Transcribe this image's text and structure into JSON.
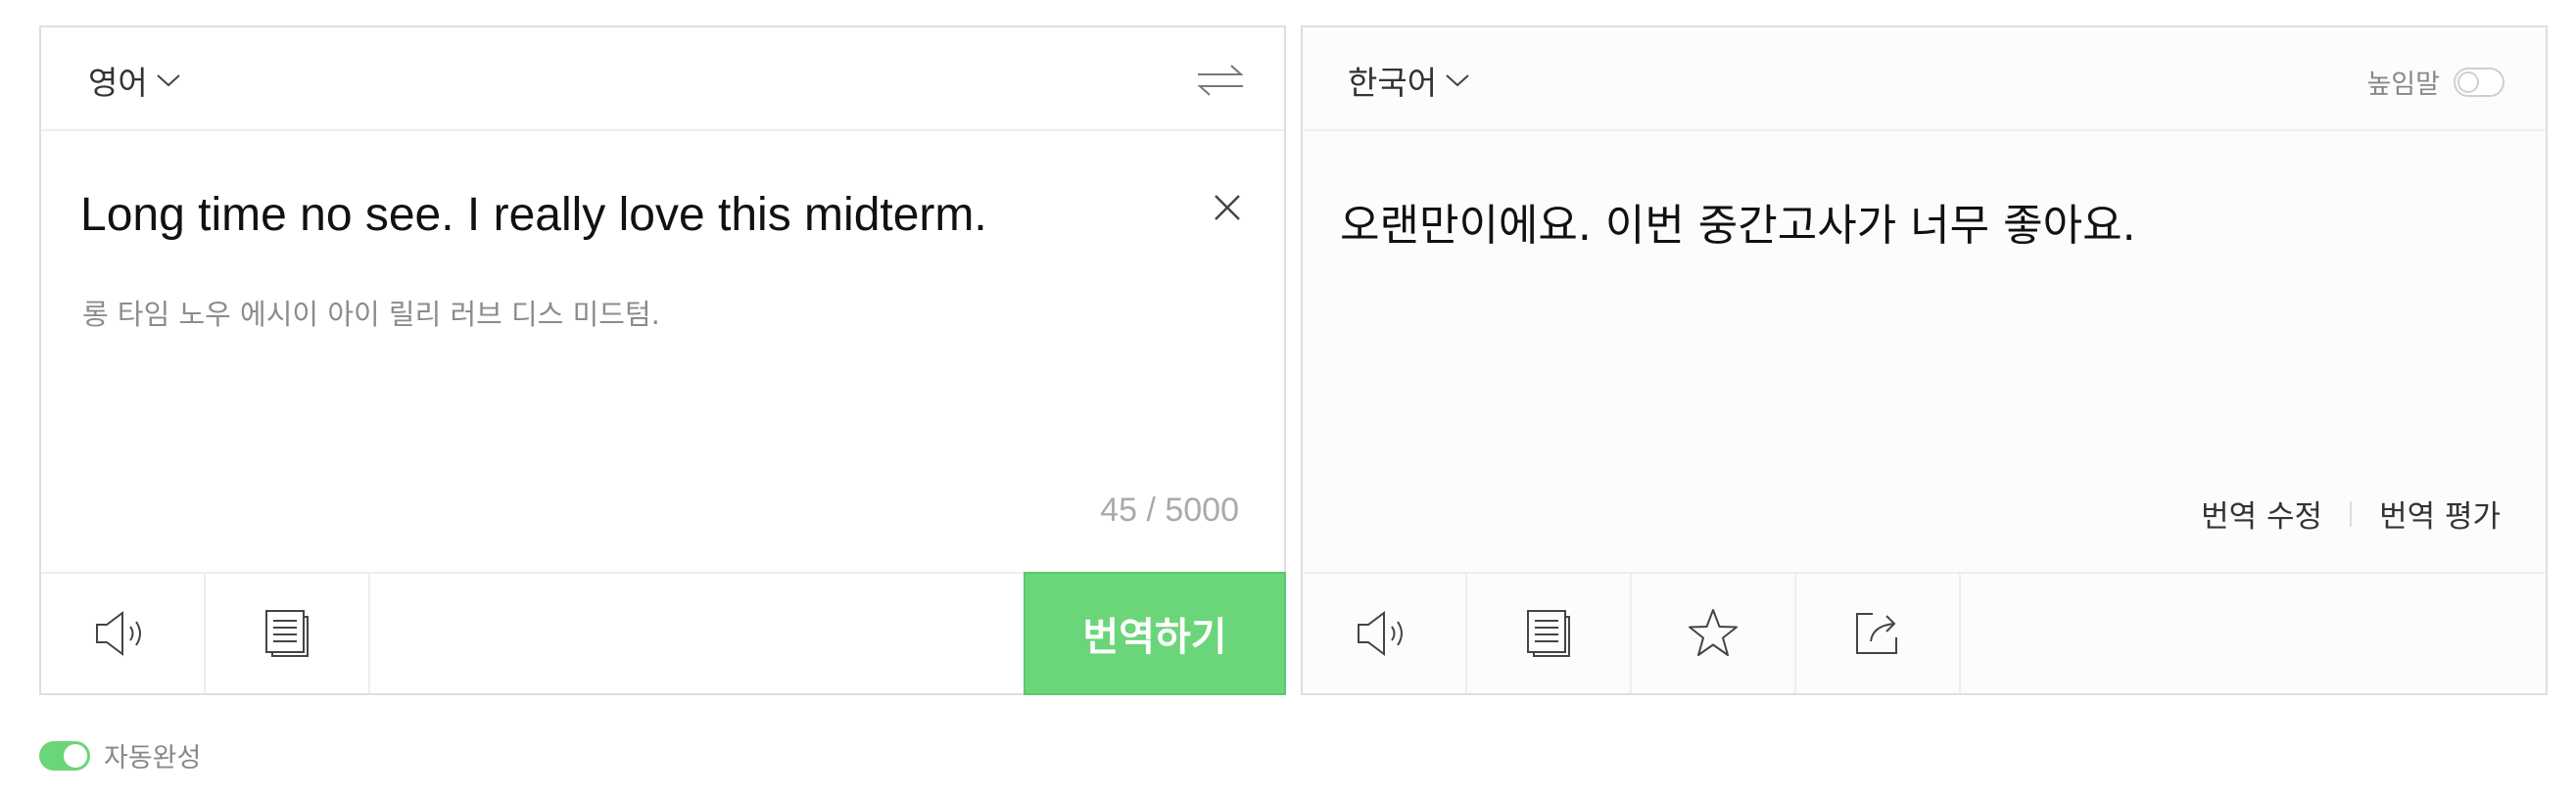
{
  "source": {
    "language": "영어",
    "text": "Long time no see. I really love this midterm.",
    "pronunciation": "롱 타임 노우 에시이 아이 릴리 러브 디스 미드텀.",
    "char_count": "45 / 5000",
    "translate_button": "번역하기",
    "icons": [
      "swap-icon",
      "clear-icon",
      "speaker-icon",
      "copy-icon"
    ]
  },
  "target": {
    "language": "한국어",
    "honorific_label": "높임말",
    "text": "오랜만이에요. 이번 중간고사가 너무 좋아요.",
    "edit_translation": "번역 수정",
    "rate_translation": "번역 평가",
    "icons": [
      "speaker-icon",
      "copy-icon",
      "star-icon",
      "share-icon"
    ]
  },
  "autocomplete": {
    "label": "자동완성",
    "enabled": true
  },
  "colors": {
    "accent_green": "#6bd57a",
    "border": "#dedede"
  }
}
